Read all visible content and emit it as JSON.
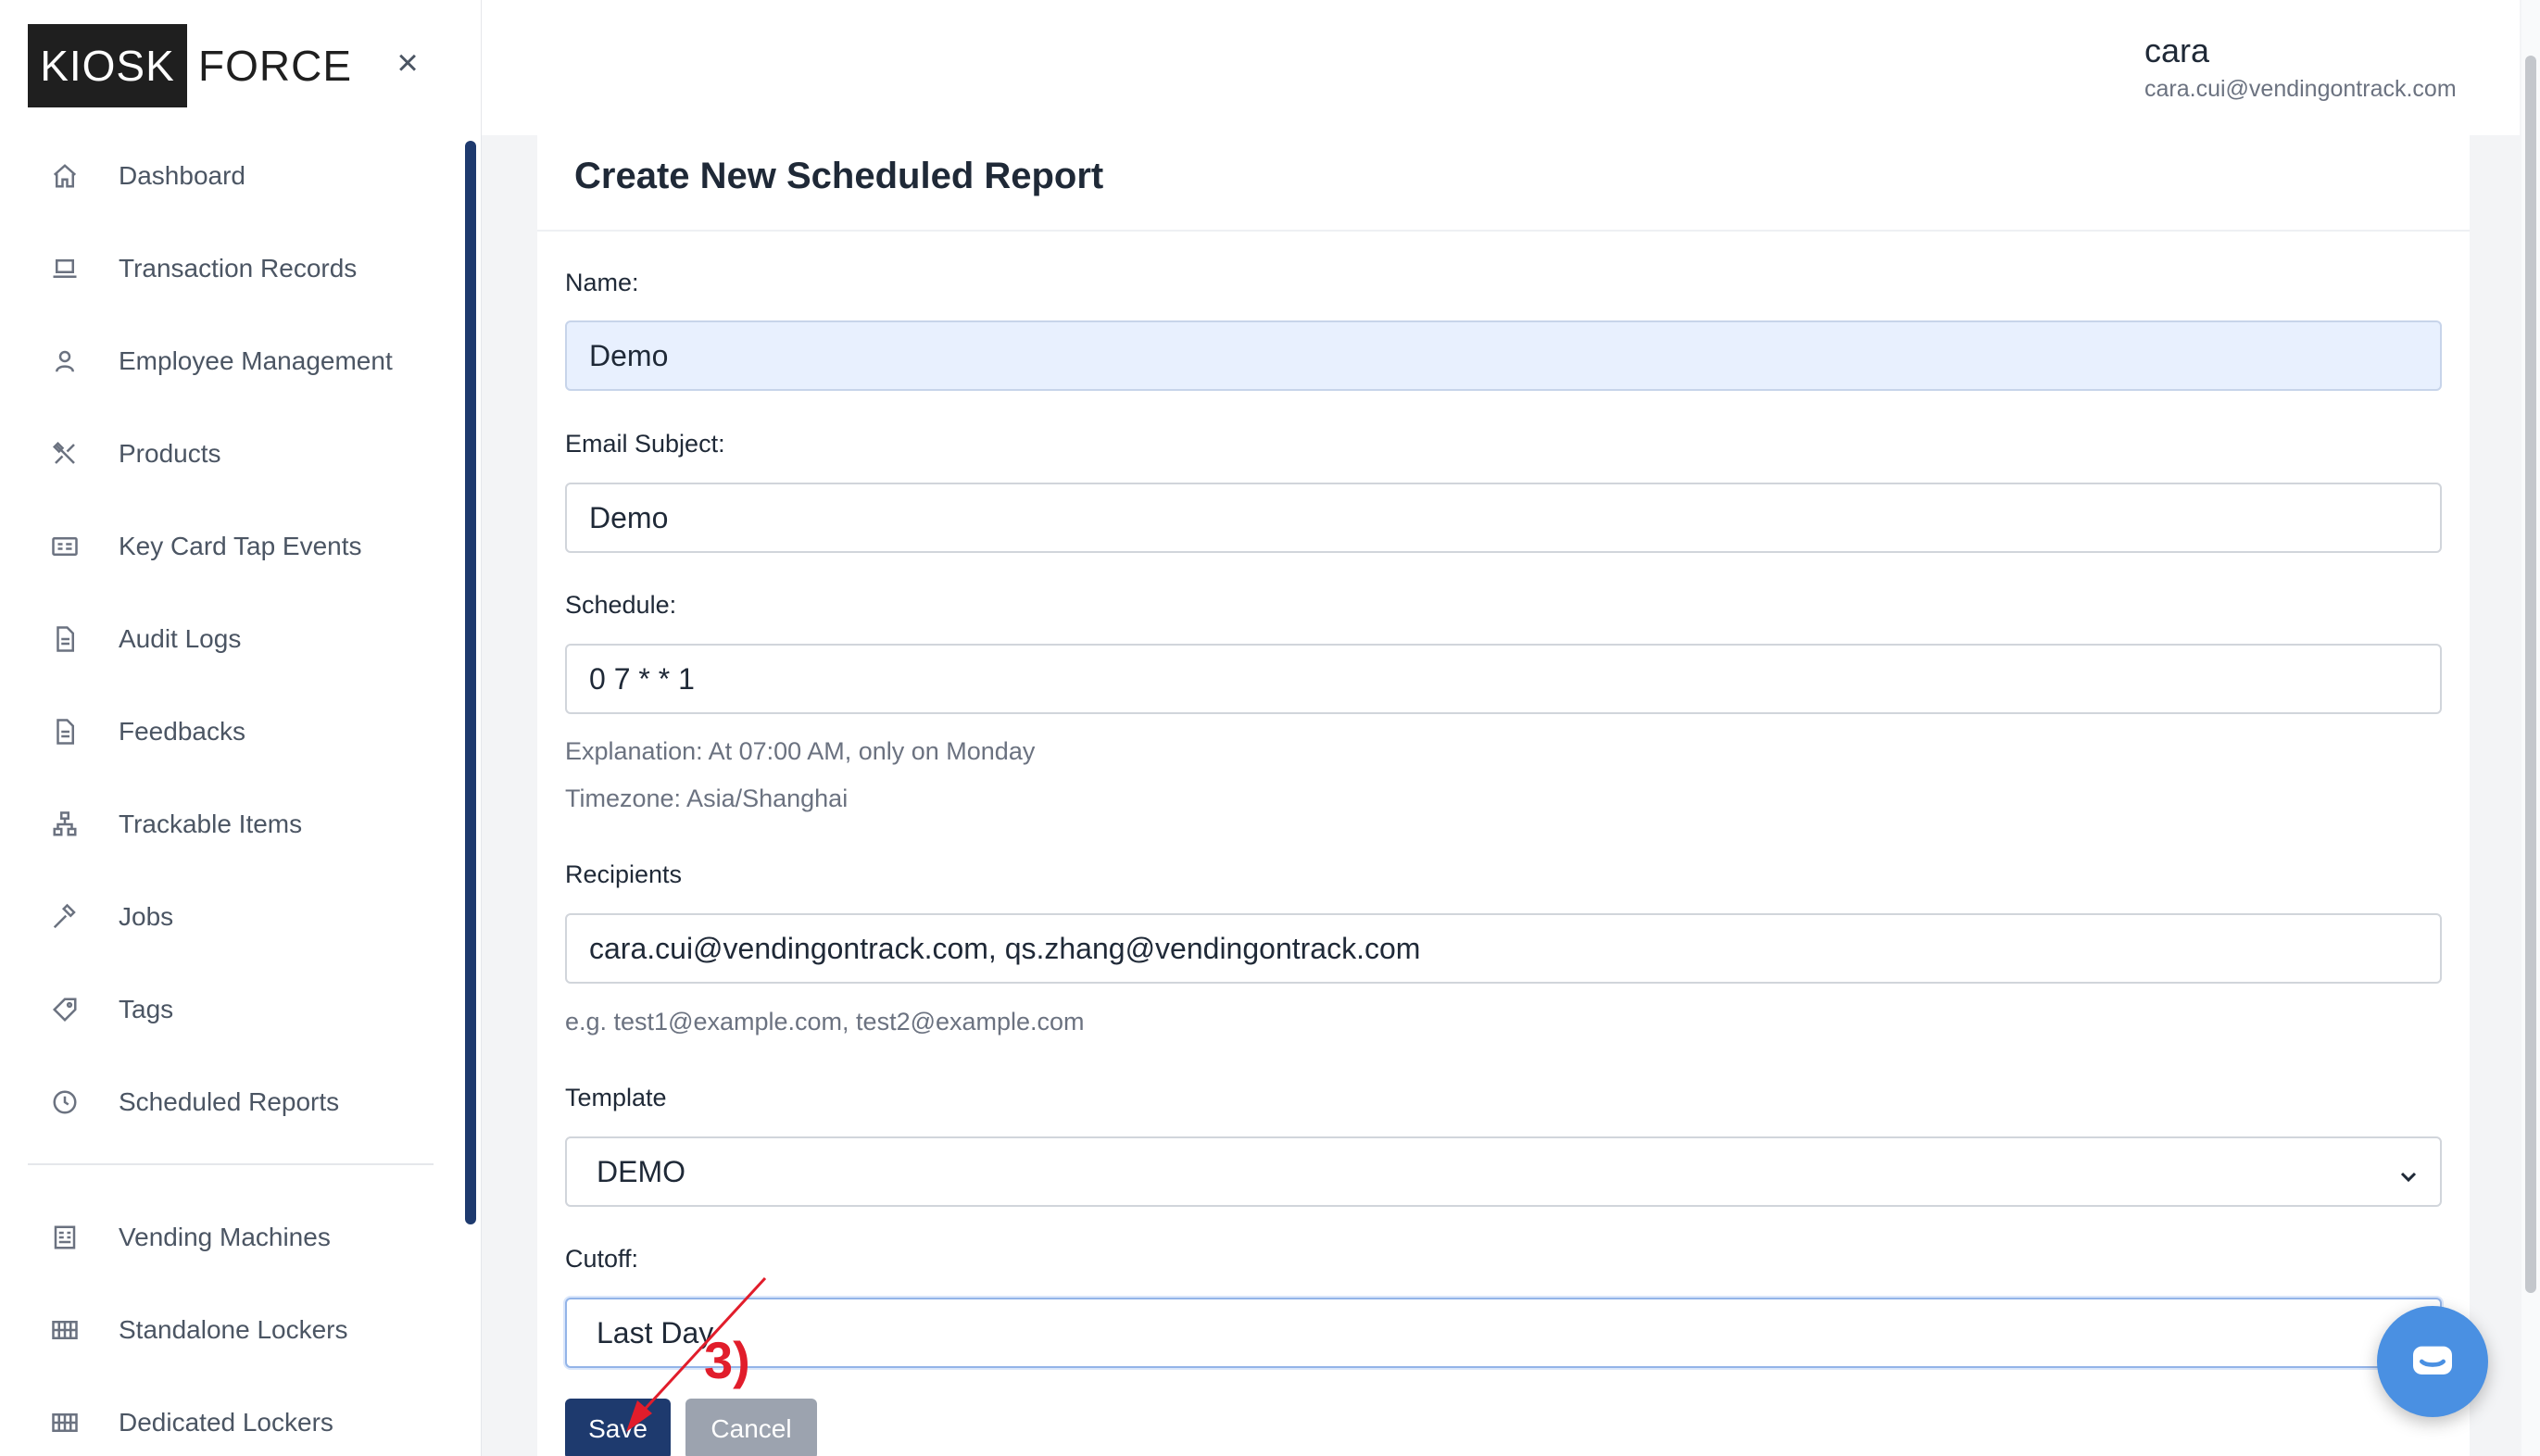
{
  "brand": {
    "part1": "KIOSK",
    "part2": "FORCE"
  },
  "sidebar": {
    "close_symbol": "×",
    "items": [
      {
        "label": "Dashboard",
        "icon": "home-icon"
      },
      {
        "label": "Transaction Records",
        "icon": "laptop-icon"
      },
      {
        "label": "Employee Management",
        "icon": "user-icon"
      },
      {
        "label": "Products",
        "icon": "tools-icon"
      },
      {
        "label": "Key Card Tap Events",
        "icon": "id-card-icon"
      },
      {
        "label": "Audit Logs",
        "icon": "file-icon"
      },
      {
        "label": "Feedbacks",
        "icon": "file-icon"
      },
      {
        "label": "Trackable Items",
        "icon": "sitemap-icon"
      },
      {
        "label": "Jobs",
        "icon": "hammer-icon"
      },
      {
        "label": "Tags",
        "icon": "tag-icon"
      },
      {
        "label": "Scheduled Reports",
        "icon": "clock-icon"
      }
    ],
    "items_secondary": [
      {
        "label": "Vending Machines",
        "icon": "machine-icon"
      },
      {
        "label": "Standalone Lockers",
        "icon": "grid-icon"
      },
      {
        "label": "Dedicated Lockers",
        "icon": "grid-icon"
      }
    ]
  },
  "header": {
    "user_name": "cara",
    "user_email": "cara.cui@vendingontrack.com"
  },
  "form": {
    "title": "Create New Scheduled Report",
    "name_label": "Name:",
    "name_value": "Demo",
    "subject_label": "Email Subject:",
    "subject_value": "Demo",
    "schedule_label": "Schedule:",
    "schedule_value": "0 7 * * 1",
    "explanation": "Explanation: At 07:00 AM, only on Monday",
    "timezone": "Timezone: Asia/Shanghai",
    "recipients_label": "Recipients",
    "recipients_value": "cara.cui@vendingontrack.com, qs.zhang@vendingontrack.com",
    "recipients_hint": "e.g. test1@example.com, test2@example.com",
    "template_label": "Template",
    "template_value": "DEMO",
    "cutoff_label": "Cutoff:",
    "cutoff_value": "Last Day",
    "save_label": "Save",
    "cancel_label": "Cancel"
  },
  "annotation": {
    "text": "3)",
    "color": "#e11d2b"
  },
  "colors": {
    "primary": "#1e3a6e",
    "chat": "#4a90e2",
    "annotation": "#e11d2b"
  }
}
